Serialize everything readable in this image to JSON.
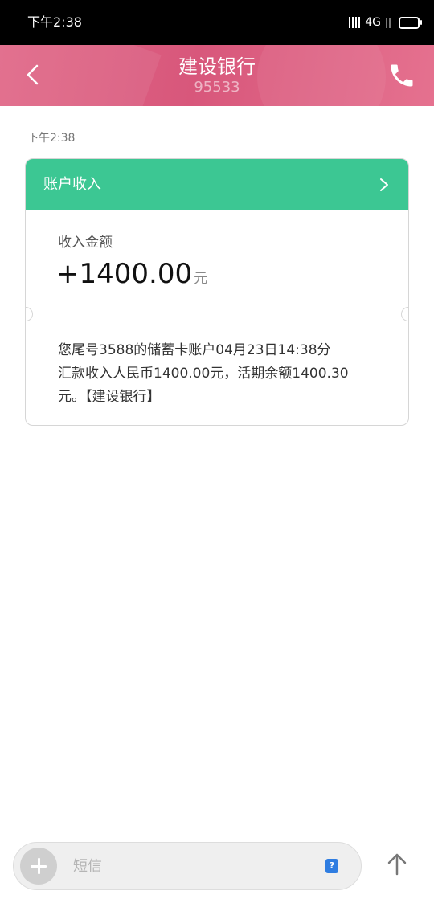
{
  "status_bar": {
    "time": "下午2:38",
    "network": "4G"
  },
  "header": {
    "title": "建设银行",
    "number": "95533"
  },
  "conversation": {
    "message_time": "下午2:38",
    "card": {
      "header_title": "账户收入",
      "amount_label": "收入金额",
      "amount": "+1400.00",
      "amount_unit": "元",
      "body_line1": "您尾号3588的储蓄卡账户04月23日14:38分",
      "body_line2": "汇款收入人民币1400.00元，活期余额1400.30",
      "body_line3": "元。【建设银行】"
    }
  },
  "input_bar": {
    "placeholder": "短信",
    "sim_label": "?"
  },
  "colors": {
    "header_bg": "#dc5f81",
    "card_header_bg": "#3cc793",
    "sim_badge": "#2f7de1"
  },
  "icons": {
    "back": "chevron-left-icon",
    "phone": "phone-icon",
    "card_arrow": "chevron-right-icon",
    "add": "plus-icon",
    "send": "arrow-up-icon"
  }
}
